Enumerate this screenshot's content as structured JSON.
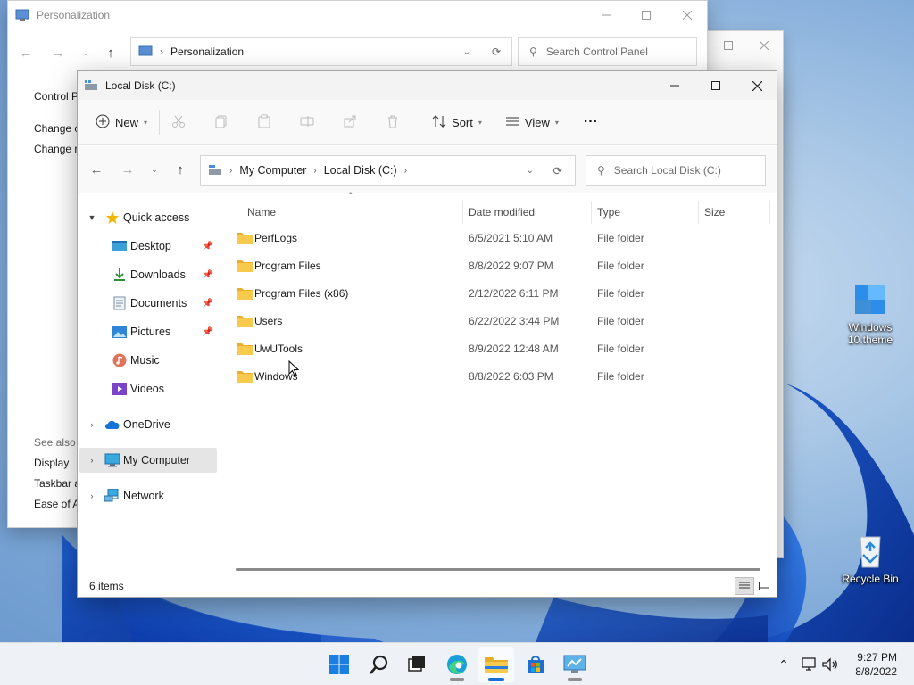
{
  "desktop": {
    "icons": [
      {
        "label": "Windows 10.theme",
        "icon": "theme-file-icon"
      },
      {
        "label": "Recycle Bin",
        "icon": "recycle-bin-icon"
      }
    ]
  },
  "control_panel": {
    "title": "Personalization",
    "address": "Personalization",
    "search_placeholder": "Search Control Panel",
    "left_items": [
      "Control P",
      "Change c",
      "Change r"
    ],
    "see_also_heading": "See also",
    "see_also_items": [
      "Display",
      "Taskbar a",
      "Ease of A"
    ]
  },
  "explorer": {
    "title": "Local Disk (C:)",
    "toolbar": {
      "new_label": "New",
      "sort_label": "Sort",
      "view_label": "View",
      "more_label": "···"
    },
    "address": {
      "crumbs": [
        "My Computer",
        "Local Disk (C:)"
      ]
    },
    "search_placeholder": "Search Local Disk (C:)",
    "nav": {
      "quick_access": "Quick access",
      "quick_items": [
        {
          "label": "Desktop",
          "icon": "desktop-icon",
          "pinned": true
        },
        {
          "label": "Downloads",
          "icon": "download-icon",
          "pinned": true
        },
        {
          "label": "Documents",
          "icon": "documents-icon",
          "pinned": true
        },
        {
          "label": "Pictures",
          "icon": "pictures-icon",
          "pinned": true
        },
        {
          "label": "Music",
          "icon": "music-icon",
          "pinned": false
        },
        {
          "label": "Videos",
          "icon": "videos-icon",
          "pinned": false
        }
      ],
      "onedrive": "OneDrive",
      "my_computer": "My Computer",
      "network": "Network",
      "selected": "My Computer"
    },
    "columns": [
      "Name",
      "Date modified",
      "Type",
      "Size"
    ],
    "rows": [
      {
        "name": "PerfLogs",
        "date": "6/5/2021 5:10 AM",
        "type": "File folder",
        "size": ""
      },
      {
        "name": "Program Files",
        "date": "8/8/2022 9:07 PM",
        "type": "File folder",
        "size": ""
      },
      {
        "name": "Program Files (x86)",
        "date": "2/12/2022 6:11 PM",
        "type": "File folder",
        "size": ""
      },
      {
        "name": "Users",
        "date": "6/22/2022 3:44 PM",
        "type": "File folder",
        "size": ""
      },
      {
        "name": "UwUTools",
        "date": "8/9/2022 12:48 AM",
        "type": "File folder",
        "size": ""
      },
      {
        "name": "Windows",
        "date": "8/8/2022 6:03 PM",
        "type": "File folder",
        "size": ""
      }
    ],
    "status": "6 items"
  },
  "taskbar": {
    "apps": [
      "start",
      "search",
      "task-view",
      "edge",
      "file-explorer",
      "store",
      "control-panel"
    ],
    "active_app": "file-explorer",
    "time": "9:27 PM",
    "date": "8/8/2022"
  },
  "colors": {
    "accent": "#0067c0",
    "folder": "#f5c244",
    "selected_bg": "#e5e5e5"
  }
}
